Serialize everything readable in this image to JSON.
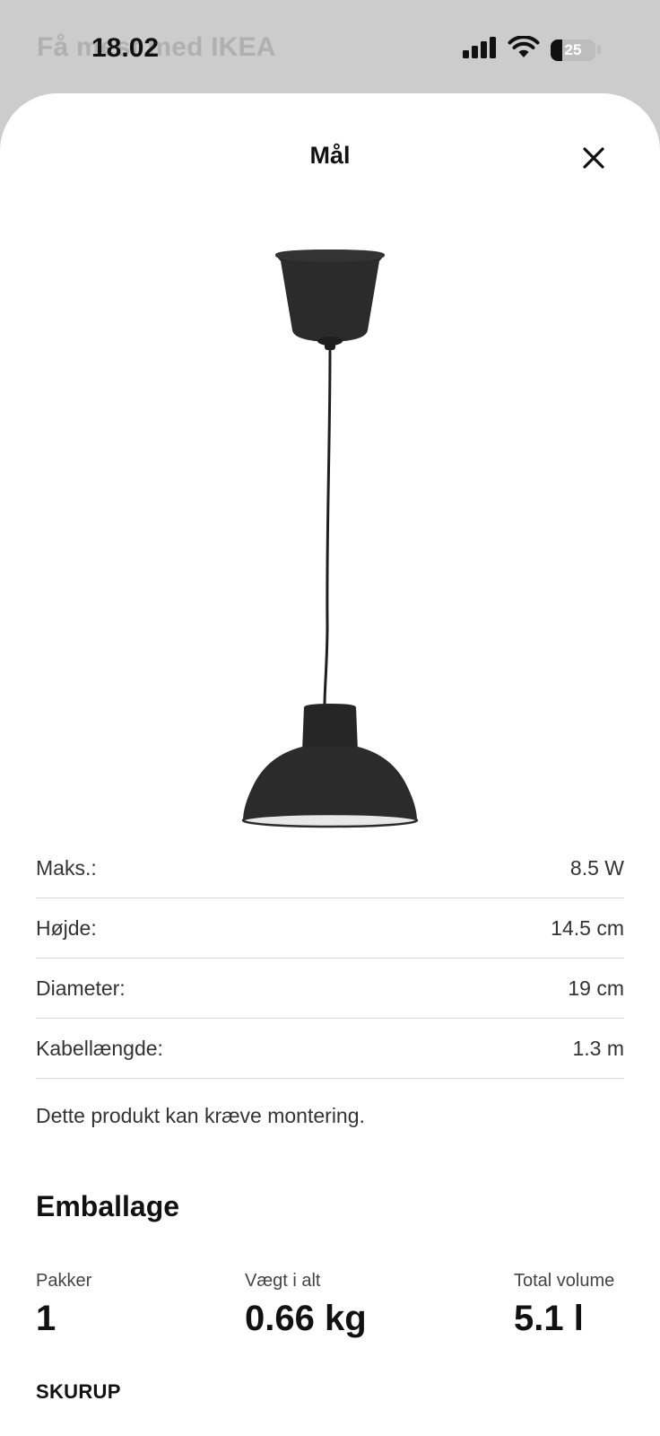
{
  "status_bar": {
    "background_title": "Få mest med IKEA",
    "time": "18.02",
    "battery_level": "25",
    "battery_fraction": 0.25
  },
  "sheet": {
    "title": "Mål",
    "close_icon": "close-icon"
  },
  "specs": [
    {
      "label": "Maks.:",
      "value": "8.5 W"
    },
    {
      "label": "Højde:",
      "value": "14.5 cm"
    },
    {
      "label": "Diameter:",
      "value": "19 cm"
    },
    {
      "label": "Kabellængde:",
      "value": "1.3 m"
    }
  ],
  "note": "Dette produkt kan kræve montering.",
  "packaging": {
    "heading": "Emballage",
    "packages_label": "Pakker",
    "packages_value": "1",
    "weight_label": "Vægt i alt",
    "weight_value": "0.66 kg",
    "volume_label": "Total volume",
    "volume_value": "5.1 l"
  },
  "product_name": "SKURUP",
  "colors": {
    "lamp": "#2b2b2b",
    "divider": "#d8d8d8"
  }
}
